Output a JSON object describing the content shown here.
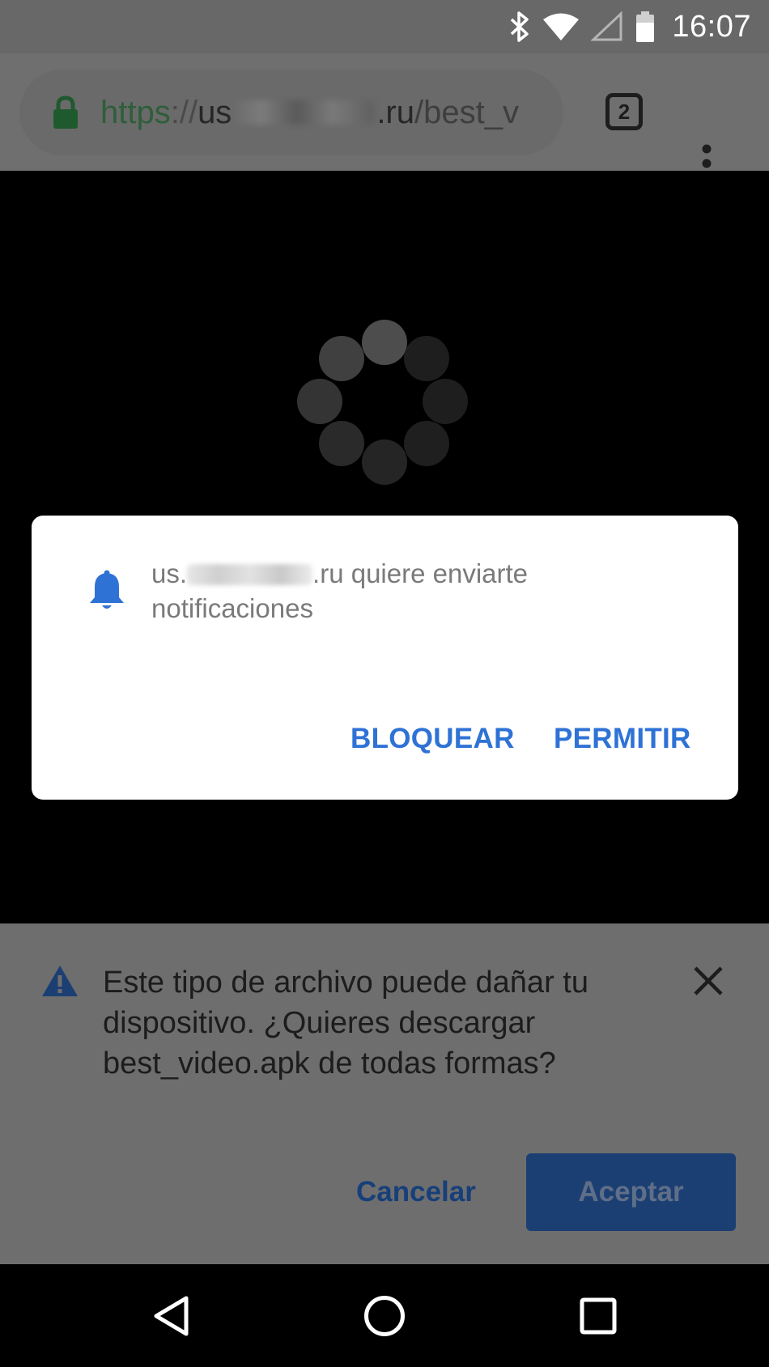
{
  "status_bar": {
    "time": "16:07",
    "icons": [
      "bluetooth-icon",
      "wifi-icon",
      "signal-icon",
      "battery-icon"
    ]
  },
  "browser": {
    "url_scheme": "https",
    "url_separator": "://",
    "url_host_start": "us",
    "url_host_end": ".ru",
    "url_path": "/best_v",
    "tab_count": "2",
    "icons": [
      "lock-icon",
      "tabs-icon",
      "more-vert-icon"
    ]
  },
  "permission_dialog": {
    "host_start": "us.",
    "host_end": ".ru",
    "message_rest": " quiere enviarte notificaciones",
    "block_label": "BLOQUEAR",
    "allow_label": "PERMITIR",
    "icon": "bell-icon"
  },
  "download_warning": {
    "message": "Este tipo de archivo puede dañar tu dispositivo. ¿Quieres descargar best_video.apk de todas formas?",
    "cancel_label": "Cancelar",
    "accept_label": "Aceptar",
    "icons": [
      "warning-icon",
      "close-icon"
    ]
  },
  "nav_bar": {
    "icons": [
      "back-icon",
      "home-icon",
      "recents-icon"
    ]
  },
  "colors": {
    "accent_blue": "#2f72d6",
    "secure_green": "#2e5e3a",
    "scrim_gray": "#6e6e6e"
  }
}
